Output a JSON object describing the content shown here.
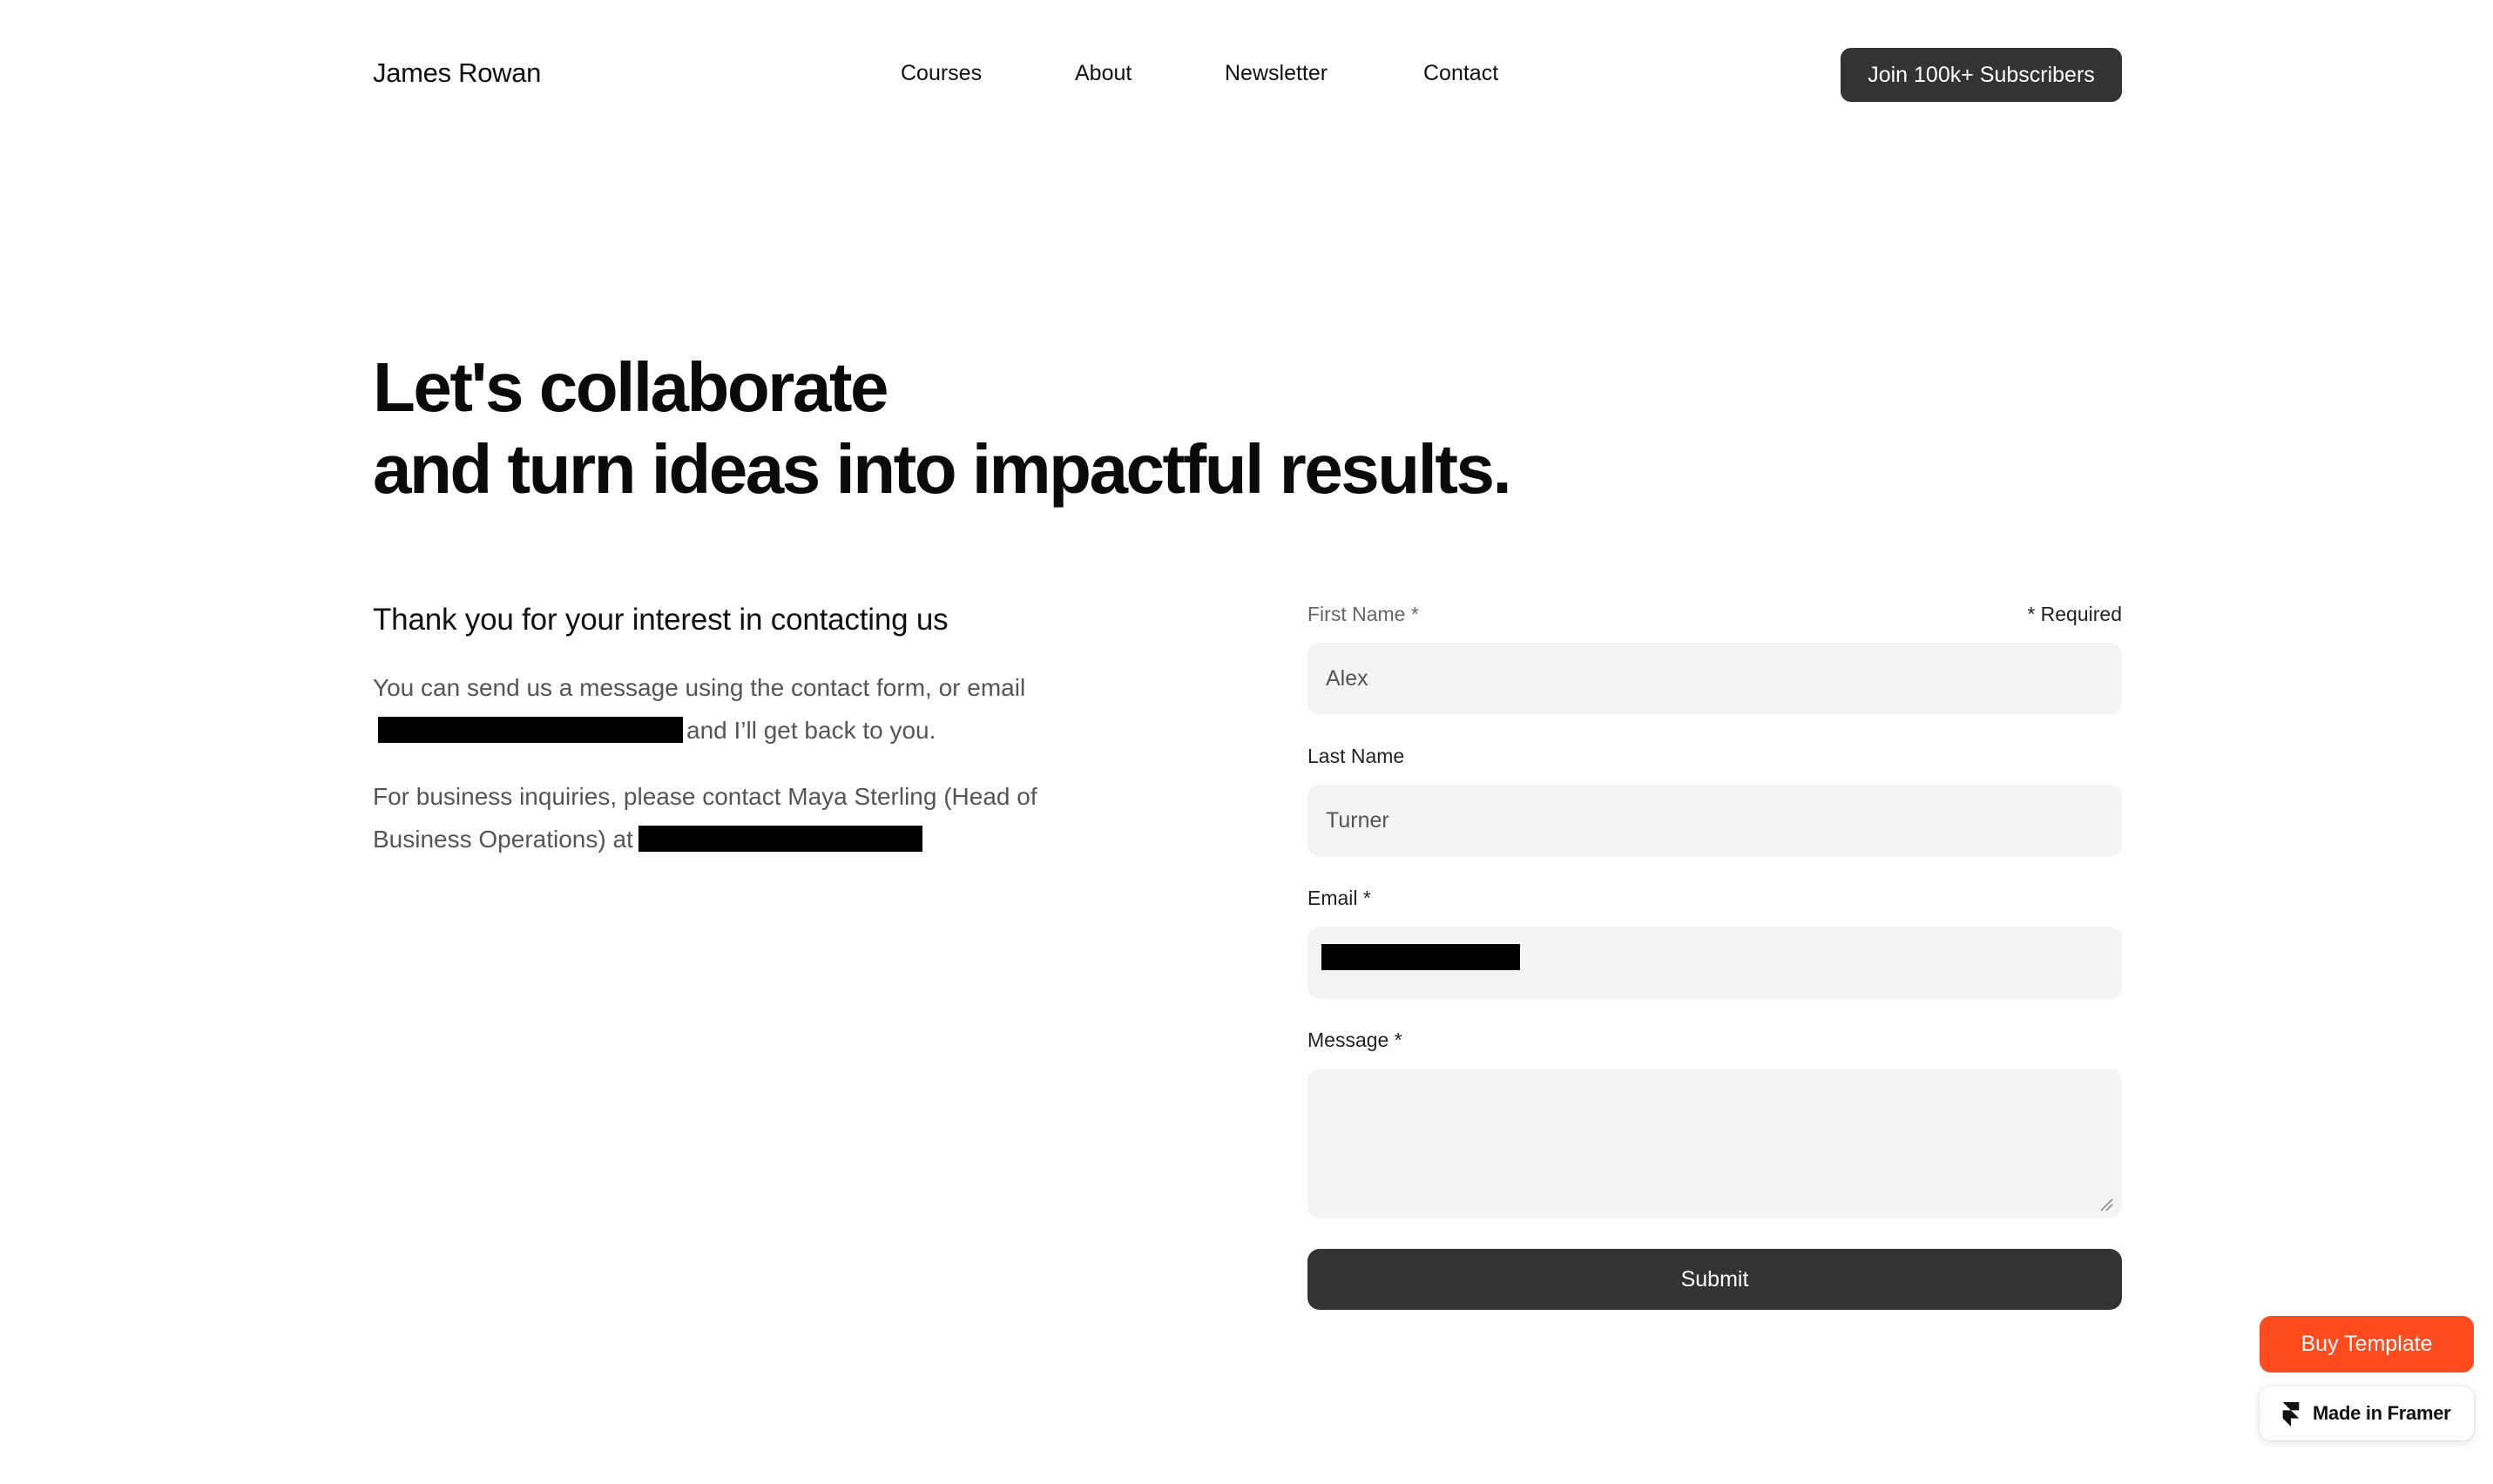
{
  "header": {
    "brand": "James Rowan",
    "nav": [
      {
        "label": "Courses"
      },
      {
        "label": "About"
      },
      {
        "label": "Newsletter"
      },
      {
        "label": "Contact"
      }
    ],
    "cta_label": "Join 100k+ Subscribers"
  },
  "hero": {
    "line1": "Let's collaborate",
    "line2": "and turn ideas into impactful results."
  },
  "intro": {
    "heading": "Thank you for your interest in contacting us",
    "p1_before": "You can send us a message using the contact form, or email",
    "p1_after": "and I’ll get back to you.",
    "p2_before": "For business inquiries, please contact Maya Sterling (Head of Business Operations) at"
  },
  "form": {
    "first_name_label": "First Name *",
    "required_note": "* Required",
    "first_name_value": "Alex",
    "last_name_label": "Last Name",
    "last_name_value": "Turner",
    "email_label": "Email *",
    "message_label": "Message *",
    "message_value": "",
    "submit_label": "Submit"
  },
  "badges": {
    "buy_label": "Buy Template",
    "framer_label": "Made in Framer",
    "buy_color": "#ff4c1e"
  },
  "icons": {
    "framer": "framer-logo-icon",
    "resize": "resize-handle-icon"
  }
}
